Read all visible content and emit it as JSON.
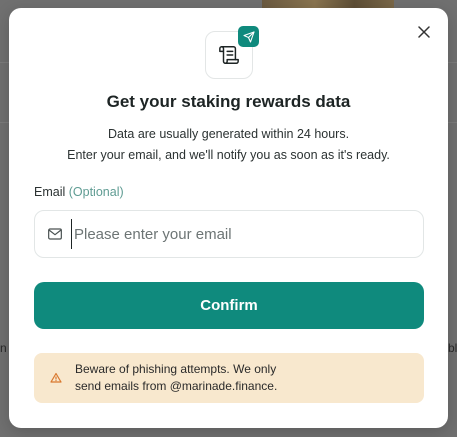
{
  "modal": {
    "title": "Get your staking rewards data",
    "description_line1": "Data are usually generated within 24 hours.",
    "description_line2": "Enter your email, and we'll notify you as soon as it's ready.",
    "email_label": "Email",
    "email_optional": "(Optional)",
    "email_placeholder": "Please enter your email",
    "email_value": "",
    "confirm_label": "Confirm",
    "warning_line1": "Beware of phishing attempts. We only",
    "warning_line2": "send emails from @marinade.finance."
  },
  "background": {
    "left_edge_text": "n",
    "right_edge_text": "bl"
  },
  "icons": {
    "close": "close-icon",
    "scroll": "scroll-icon",
    "send": "send-icon",
    "mail": "mail-icon",
    "warning": "warning-icon"
  },
  "colors": {
    "accent": "#0f8a7d",
    "warning_bg": "#f8e8ce",
    "warning_icon": "#d9782e",
    "optional_text": "#5f9c93"
  }
}
